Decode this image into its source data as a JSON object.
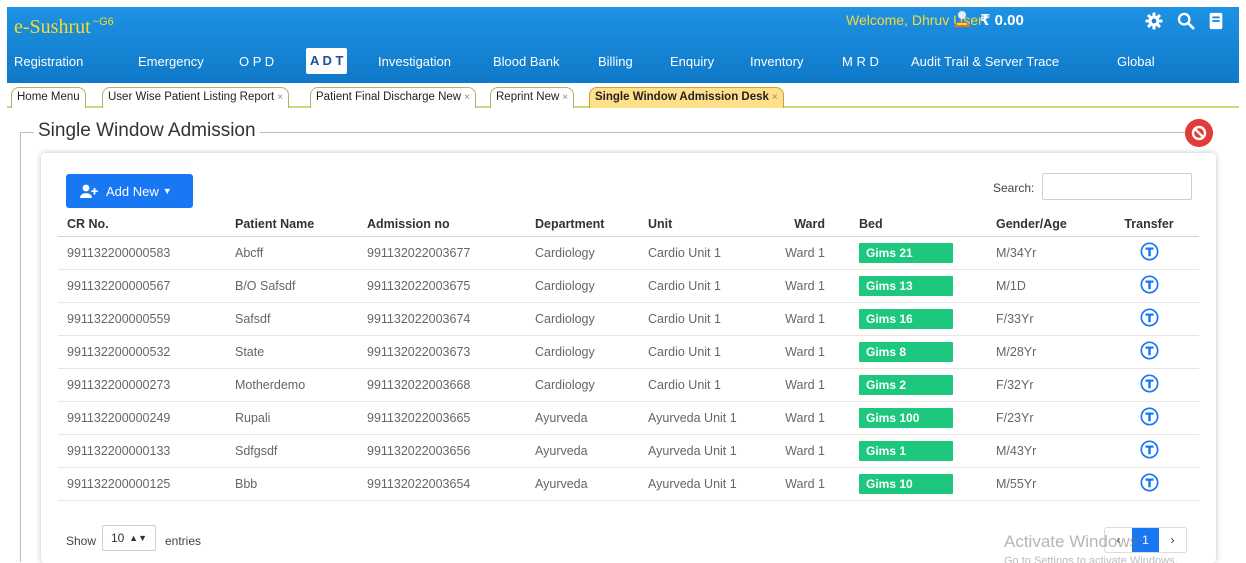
{
  "app": {
    "brand": "e-Sushrut",
    "brand_sup": "~G6"
  },
  "header": {
    "welcome": "Welcome, Dhruv User",
    "amount": "₹ 0.00"
  },
  "nav": {
    "items": [
      "Registration",
      "Emergency",
      "O P D",
      "A D T",
      "Investigation",
      "Blood Bank",
      "Billing",
      "Enquiry",
      "Inventory",
      "M R D",
      "Audit Trail & Server Trace",
      "Global"
    ],
    "active_index": 3
  },
  "tabs": [
    {
      "label": "Home Menu",
      "closable": false
    },
    {
      "label": "User Wise Patient Listing Report",
      "closable": true
    },
    {
      "label": "Patient Final Discharge New",
      "closable": true
    },
    {
      "label": "Reprint New",
      "closable": true
    },
    {
      "label": "Single Window Admission Desk",
      "closable": true
    }
  ],
  "active_tab_index": 4,
  "tab_close_glyph": "×",
  "page": {
    "title": "Single Window Admission"
  },
  "toolbar": {
    "add_label": "Add New",
    "search_label": "Search:",
    "search_value": ""
  },
  "table": {
    "columns": [
      "CR No.",
      "Patient Name",
      "Admission no",
      "Department",
      "Unit",
      "Ward",
      "Bed",
      "Gender/Age",
      "Transfer"
    ],
    "rows": [
      {
        "cr": "991132200000583",
        "name": "Abcff",
        "admission": "991132022003677",
        "department": "Cardiology",
        "unit": "Cardio Unit 1",
        "ward": "Ward 1",
        "bed": "Gims 21",
        "gender_age": "M/34Yr"
      },
      {
        "cr": "991132200000567",
        "name": "B/O Safsdf",
        "admission": "991132022003675",
        "department": "Cardiology",
        "unit": "Cardio Unit 1",
        "ward": "Ward 1",
        "bed": "Gims 13",
        "gender_age": "M/1D"
      },
      {
        "cr": "991132200000559",
        "name": "Safsdf",
        "admission": "991132022003674",
        "department": "Cardiology",
        "unit": "Cardio Unit 1",
        "ward": "Ward 1",
        "bed": "Gims 16",
        "gender_age": "F/33Yr"
      },
      {
        "cr": "991132200000532",
        "name": "State",
        "admission": "991132022003673",
        "department": "Cardiology",
        "unit": "Cardio Unit 1",
        "ward": "Ward 1",
        "bed": "Gims 8",
        "gender_age": "M/28Yr"
      },
      {
        "cr": "991132200000273",
        "name": "Motherdemo",
        "admission": "991132022003668",
        "department": "Cardiology",
        "unit": "Cardio Unit 1",
        "ward": "Ward 1",
        "bed": "Gims 2",
        "gender_age": "F/32Yr"
      },
      {
        "cr": "991132200000249",
        "name": "Rupali",
        "admission": "991132022003665",
        "department": "Ayurveda",
        "unit": "Ayurveda Unit 1",
        "ward": "Ward 1",
        "bed": "Gims 100",
        "gender_age": "F/23Yr"
      },
      {
        "cr": "991132200000133",
        "name": "Sdfgsdf",
        "admission": "991132022003656",
        "department": "Ayurveda",
        "unit": "Ayurveda Unit 1",
        "ward": "Ward 1",
        "bed": "Gims 1",
        "gender_age": "M/43Yr"
      },
      {
        "cr": "991132200000125",
        "name": "Bbb",
        "admission": "991132022003654",
        "department": "Ayurveda",
        "unit": "Ayurveda Unit 1",
        "ward": "Ward 1",
        "bed": "Gims 10",
        "gender_age": "M/55Yr"
      }
    ]
  },
  "footer": {
    "show_label": "Show",
    "entries_value": "10",
    "entries_label": "entries",
    "current_page": "1"
  },
  "overlay": {
    "watermark": "Activate Windows",
    "watermark_sub": "Go to Settings to activate Windows."
  },
  "colors": {
    "header": "#1281d6",
    "brand": "#f4dc2b",
    "welcome": "#f5d93c",
    "bed_chip": "#1dc87e",
    "primary_button": "#1877f2",
    "close_button": "#e23b3b",
    "active_tab": "#ffe08a"
  },
  "icons": {
    "user": "user-money-icon",
    "settings": "gear-icon",
    "search": "search-icon",
    "notes": "notes-icon",
    "close": "stop-icon",
    "add": "add-user-icon",
    "transfer": "transfer-t-icon"
  }
}
